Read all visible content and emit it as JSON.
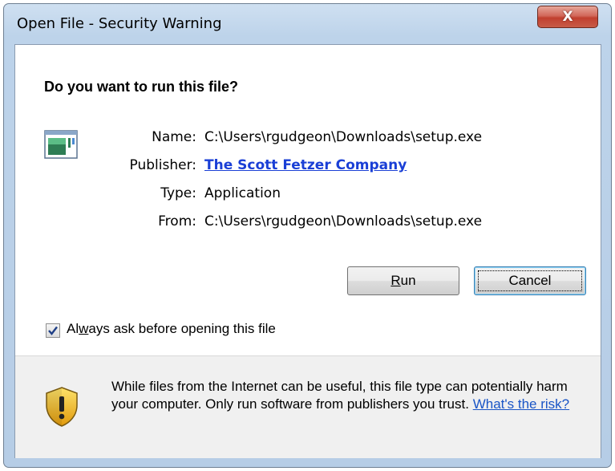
{
  "window": {
    "title": "Open File - Security Warning",
    "close_glyph": "X"
  },
  "dialog": {
    "question": "Do you want to run this file?",
    "fields": [
      {
        "label": "Name:",
        "value": "C:\\Users\\rgudgeon\\Downloads\\setup.exe"
      },
      {
        "label": "Publisher:",
        "value": "The Scott Fetzer Company"
      },
      {
        "label": "Type:",
        "value": "Application"
      },
      {
        "label": "From:",
        "value": "C:\\Users\\rgudgeon\\Downloads\\setup.exe"
      }
    ],
    "buttons": {
      "run_label_accel": "R",
      "run_label_rest": "un",
      "cancel_label": "Cancel"
    },
    "checkbox": {
      "checked": true,
      "label_pre": "Al",
      "label_accel": "w",
      "label_post": "ays ask before opening this file"
    },
    "warning": {
      "text": "While files from the Internet can be useful, this file type can potentially harm your computer. Only run software from publishers you trust.",
      "link": "What's the risk?"
    }
  },
  "colors": {
    "link": "#1a3fd6",
    "close_button": "#c1402f",
    "shield_yellow": "#f2c21a"
  },
  "icons": [
    "close-icon",
    "application-file-icon",
    "checkmark-icon",
    "warning-shield-icon"
  ]
}
